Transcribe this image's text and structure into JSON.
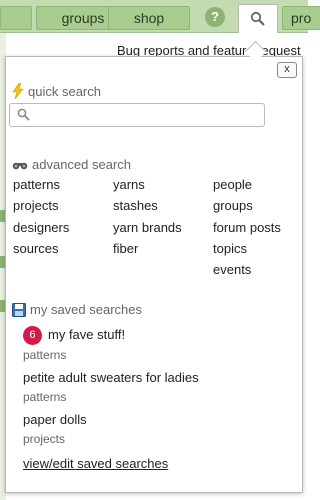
{
  "nav": {
    "groups": "groups",
    "shop": "shop",
    "help": "?",
    "partial": "pro"
  },
  "behind_text": "Bug reports and feature request",
  "popup": {
    "close": "x",
    "quick_search_label": "quick search",
    "advanced_search_label": "advanced search",
    "advanced": {
      "col1": [
        "patterns",
        "projects",
        "designers",
        "sources"
      ],
      "col2": [
        "yarns",
        "stashes",
        "yarn brands",
        "fiber"
      ],
      "col3": [
        "people",
        "groups",
        "forum posts",
        "topics",
        "events"
      ]
    },
    "saved_label": "my saved searches",
    "saved": [
      {
        "badge": "6",
        "title": "my fave stuff!",
        "sub": "patterns"
      },
      {
        "title": "petite adult sweaters for ladies",
        "sub": "patterns"
      },
      {
        "title": "paper dolls",
        "sub": "projects"
      }
    ],
    "view_edit": "view/edit saved searches"
  },
  "colors": {
    "accent": "#d21a4c",
    "nav": "#a9cc8f"
  }
}
